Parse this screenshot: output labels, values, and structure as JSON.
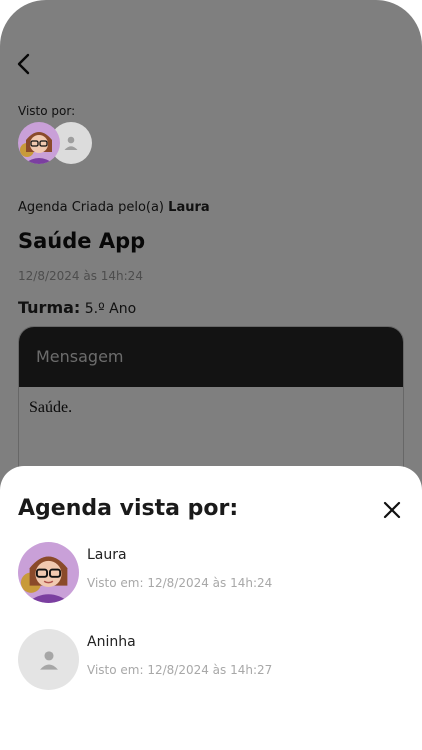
{
  "header": {
    "back_icon": "chevron-left-icon"
  },
  "seen_by": {
    "label": "Visto por:",
    "avatars": [
      {
        "name": "Laura",
        "kind": "cartoon"
      },
      {
        "name": "Aninha",
        "kind": "placeholder"
      }
    ]
  },
  "agenda": {
    "created_prefix": "Agenda Criada pelo(a)",
    "created_by": "Laura",
    "title": "Saúde App",
    "date": "12/8/2024 às 14h:24",
    "turma_label": "Turma:",
    "turma_value": "5.º Ano",
    "message_label": "Mensagem",
    "message_text": "Saúde."
  },
  "sheet": {
    "title": "Agenda vista por:",
    "close_icon": "close-icon",
    "viewers": [
      {
        "name": "Laura",
        "seen": "Visto em: 12/8/2024 às 14h:24"
      },
      {
        "name": "Aninha",
        "seen": "Visto em: 12/8/2024 às 14h:27"
      }
    ]
  },
  "colors": {
    "overlay": "#000000",
    "message_header": "#262626",
    "muted_text": "#a8a8a8"
  }
}
